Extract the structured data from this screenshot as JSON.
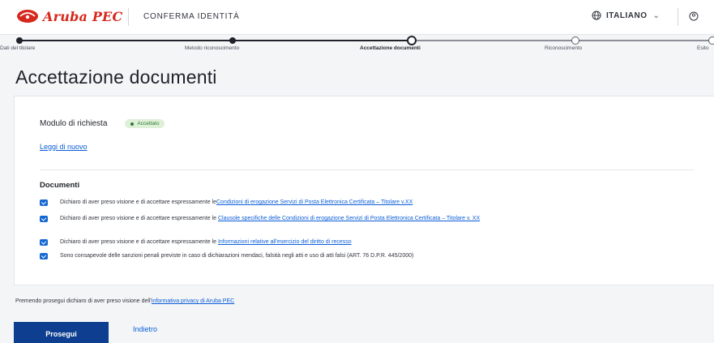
{
  "header": {
    "brand": "Aruba",
    "brand_suffix": "PEC",
    "title": "CONFERMA IDENTITÀ",
    "language": "ITALIANO",
    "icons": {
      "logo": "aruba-logo-icon",
      "globe": "globe-icon",
      "chevron": "chevron-down-icon",
      "user": "user-icon"
    }
  },
  "stepper": {
    "steps": [
      {
        "label": "Dati del titolare",
        "state": "done"
      },
      {
        "label": "Metodo riconoscimento",
        "state": "done"
      },
      {
        "label": "Accettazione documenti",
        "state": "current"
      },
      {
        "label": "Riconoscimento",
        "state": "todo"
      },
      {
        "label": "Esito",
        "state": "todo"
      }
    ]
  },
  "page": {
    "title": "Accettazione documenti"
  },
  "card": {
    "modulo_label": "Modulo di richiesta",
    "modulo_status": "Accettato",
    "reload_link": "Leggi di nuovo",
    "documents_heading": "Documenti",
    "documents": [
      {
        "checked": true,
        "text": "Dichiaro di aver preso visione e di accettare espressamente le",
        "link": "Condizioni di erogazione Servizi di Posta Elettronica Certificata – Titolare v.XX"
      },
      {
        "checked": true,
        "text": "Dichiaro di aver preso visione e di accettare espressamente le",
        "link": "Clausole specifiche delle Condizioni di erogazione Servizi di Posta Elettronica Certificata – Titolare v. XX"
      },
      {
        "checked": true,
        "text": "Dichiaro di aver preso visione e di accettare espressamente le",
        "link": "Informazioni relative all'esercizio del diritto di recesso"
      },
      {
        "checked": true,
        "text": "Sono consapevole delle sanzioni penali previste in caso di dichiarazioni mendaci, falsità negli atti e uso di atti falsi (ART. 76 D.P.R. 445/2000)",
        "link": ""
      }
    ]
  },
  "footer": {
    "privacy_text": "Premendo prosegui dichiaro di aver preso visione dell'",
    "privacy_link": "informativa privacy di Aruba PEC",
    "proceed_label": "Prosegui",
    "back_label": "Indietro"
  },
  "colors": {
    "brand_red": "#d6281d",
    "primary_button": "#0d3e8f",
    "link": "#0b5ed7",
    "checkbox": "#1567d3",
    "status_green": "#2d7a33"
  }
}
